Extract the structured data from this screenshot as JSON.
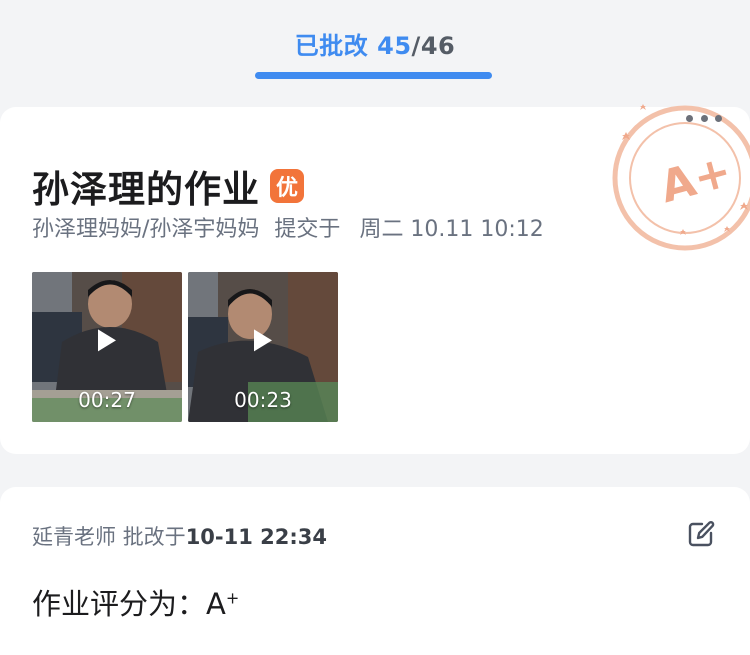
{
  "tab": {
    "label": "已批改",
    "count": "45",
    "total": "/46"
  },
  "homework": {
    "title": "孙泽理的作业",
    "badge": "优",
    "submitters": "孙泽理妈妈/孙泽宇妈妈",
    "submit_label": "提交于",
    "submit_time": "周二 10.11 10:12",
    "stamp_grade": "A+",
    "videos": [
      {
        "duration": "00:27"
      },
      {
        "duration": "00:23"
      }
    ]
  },
  "review": {
    "teacher": "延青老师",
    "reviewed_label": "批改于",
    "reviewed_time": "10-11 22:34",
    "grade_prefix": "作业评分为：",
    "grade": "A",
    "grade_sup": "+"
  },
  "colors": {
    "accent": "#3f8bf0",
    "badge": "#f2743a",
    "stamp": "#f0a98c"
  },
  "icons": {
    "more": "more-dots-icon",
    "edit": "edit-icon",
    "play": "play-icon"
  }
}
